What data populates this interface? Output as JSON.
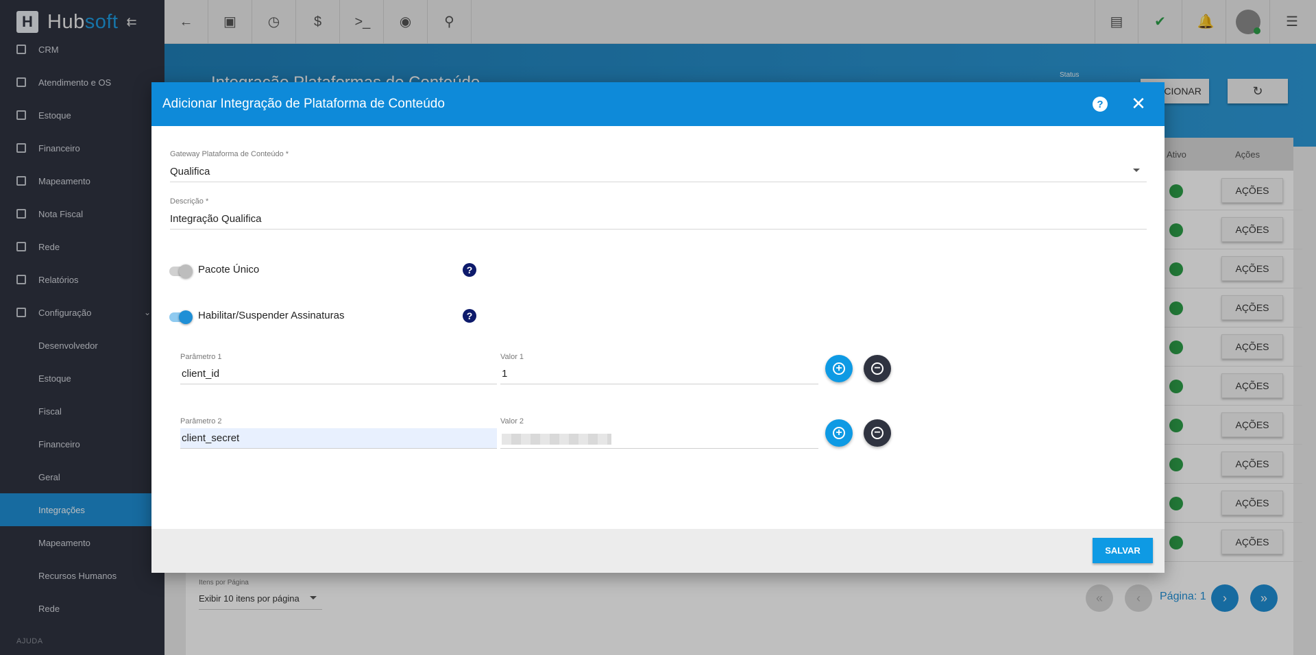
{
  "brand": {
    "hub": "Hub",
    "soft": "soft",
    "collapse_icon": "collapse-menu-icon"
  },
  "sidebar": {
    "items": [
      {
        "label": "CRM",
        "icon": "crm-icon"
      },
      {
        "label": "Atendimento e OS",
        "icon": "clock-icon"
      },
      {
        "label": "Estoque",
        "icon": "box-icon"
      },
      {
        "label": "Financeiro",
        "icon": "money-icon"
      },
      {
        "label": "Mapeamento",
        "icon": "map-pin-icon"
      },
      {
        "label": "Nota Fiscal",
        "icon": "invoice-icon"
      },
      {
        "label": "Rede",
        "icon": "server-icon"
      },
      {
        "label": "Relatórios",
        "icon": "report-icon"
      },
      {
        "label": "Configuração",
        "icon": "gear-icon"
      }
    ],
    "sub_items": [
      {
        "label": "Desenvolvedor"
      },
      {
        "label": "Estoque"
      },
      {
        "label": "Fiscal"
      },
      {
        "label": "Financeiro"
      },
      {
        "label": "Geral"
      },
      {
        "label": "Integrações",
        "active": true
      },
      {
        "label": "Mapeamento"
      },
      {
        "label": "Recursos Humanos"
      },
      {
        "label": "Rede"
      }
    ],
    "footer": "AJUDA"
  },
  "topbar": {
    "left_icons": [
      "back-arrow-icon",
      "contact-card-icon",
      "calendar-clock-icon",
      "dollar-icon",
      "terminal-icon",
      "eye-icon",
      "search-icon"
    ],
    "right_icons": [
      "pdf-icon",
      "chat-check-icon",
      "alarm-bell-icon",
      "user-avatar",
      "menu-list-icon"
    ]
  },
  "background": {
    "page_title": "Integração Plataformas de Conteúdo",
    "status_label": "Status",
    "add_button": "ADICIONAR",
    "table_headers": {
      "ativo": "Ativo",
      "acoes": "Ações"
    },
    "row_action_label": "AÇÕES",
    "row_count": 10,
    "items_per_page_label": "Itens por Página",
    "items_per_page_value": "Exibir 10 itens por página",
    "page_label": "Página: 1"
  },
  "modal": {
    "title": "Adicionar Integração de Plataforma de Conteúdo",
    "help_icon": "help-circle-icon",
    "close_icon": "close-icon",
    "gateway": {
      "label": "Gateway Plataforma de Conteúdo *",
      "value": "Qualifica"
    },
    "descricao": {
      "label": "Descrição *",
      "value": "Integração Qualifica"
    },
    "toggles": [
      {
        "label": "Pacote Único",
        "on": false
      },
      {
        "label": "Habilitar/Suspender Assinaturas",
        "on": true
      }
    ],
    "params": [
      {
        "param_label": "Parâmetro 1",
        "param_value": "client_id",
        "value_label": "Valor 1",
        "value": "1"
      },
      {
        "param_label": "Parâmetro 2",
        "param_value": "client_secret",
        "value_label": "Valor 2",
        "value": ""
      }
    ],
    "save_label": "SALVAR"
  },
  "colors": {
    "primary": "#0e8ad9",
    "sidebar": "#2f3340",
    "active": "#1f8fd6",
    "success": "#2ea04a",
    "danger": "#e53935"
  }
}
